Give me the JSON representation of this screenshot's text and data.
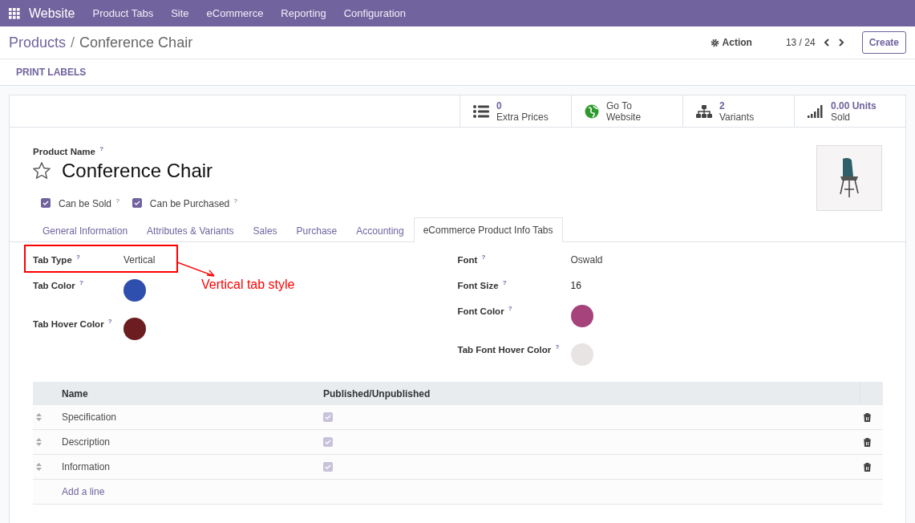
{
  "navbar": {
    "app": "Website",
    "menus": [
      "Product Tabs",
      "Site",
      "eCommerce",
      "Reporting",
      "Configuration"
    ]
  },
  "breadcrumb": {
    "parent": "Products",
    "separator": "/",
    "current": "Conference Chair"
  },
  "action": "Action",
  "pager": "13 / 24",
  "create": "Create",
  "print_labels": "PRINT LABELS",
  "smart_buttons": [
    {
      "kind": "list",
      "value": "0",
      "label": "Extra Prices"
    },
    {
      "kind": "globe",
      "value": "Go To",
      "label": "Website"
    },
    {
      "kind": "sitemap",
      "value": "2",
      "label": "Variants"
    },
    {
      "kind": "signal",
      "value": "0.00 Units",
      "label": "Sold"
    }
  ],
  "product_name_label": "Product Name $^{?}$",
  "product_name": "Conference Chair",
  "favorite": false,
  "options": [
    {
      "label": "Can be Sold $^{?}$",
      "checked": true
    },
    {
      "label": "Can be Purchased $^{?}$",
      "checked": true
    }
  ],
  "tabs": [
    {
      "label": "General Information",
      "selected": false
    },
    {
      "label": "Attributes & Variants",
      "selected": false
    },
    {
      "label": "Sales",
      "selected": false
    },
    {
      "label": "Purchase",
      "selected": false
    },
    {
      "label": "Accounting",
      "selected": false
    },
    {
      "label": "eCommerce Product Info Tabs",
      "selected": true
    }
  ],
  "left_fields": [
    {
      "kind": "text",
      "label": "Tab Type $^{?}$",
      "value": "Vertical"
    },
    {
      "kind": "color",
      "label": "Tab Color $^{?}$",
      "color": "#2e4fad"
    },
    {
      "kind": "color",
      "label": "Tab Hover Color $^{?}$",
      "color": "#6b1d1f"
    }
  ],
  "right_fields": [
    {
      "kind": "text",
      "label": "Font $^{?}$",
      "value": "Oswald"
    },
    {
      "kind": "number",
      "label": "Font Size $^{?}$",
      "value": "16"
    },
    {
      "kind": "color",
      "label": "Font Color $^{?}$",
      "color": "#a6427c"
    },
    {
      "kind": "color",
      "label": "Tab Font Hover Color $^{?}$",
      "color": "#e8e4e4"
    }
  ],
  "annotation": {
    "text": "Vertical tab style"
  },
  "table": {
    "columns": [
      "Name",
      "Published/Unpublished"
    ],
    "rows": [
      {
        "name": "Specification",
        "published": true
      },
      {
        "name": "Description",
        "published": true
      },
      {
        "name": "Information",
        "published": true
      }
    ],
    "add_line": "Add a line"
  }
}
